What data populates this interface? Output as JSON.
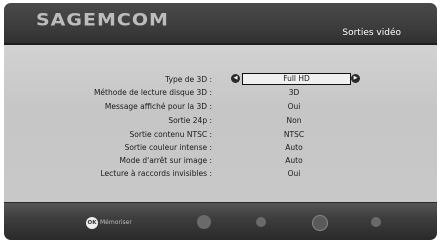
{
  "header": {
    "brand": "SAGEMCOM",
    "title": "Sorties vidéo"
  },
  "settings": [
    {
      "label": "Type de 3D :",
      "value": "Full HD"
    },
    {
      "label": "Méthode de lecture disque 3D :",
      "value": "3D"
    },
    {
      "label": "Message affiché pour la 3D :",
      "value": "Oui"
    },
    {
      "label": "Sortie  24p :",
      "value": "Non"
    },
    {
      "label": "Sortie contenu NTSC :",
      "value": "NTSC"
    },
    {
      "label": "Sortie couleur intense :",
      "value": "Auto"
    },
    {
      "label": "Mode d'arrêt sur image :",
      "value": "Auto"
    },
    {
      "label": "Lecture à raccords invisibles :",
      "value": "Oui"
    }
  ],
  "footer": {
    "ok_icon": "OK",
    "ok_label": "Mémoriser"
  },
  "icons": {
    "left": "left-arrow-icon",
    "right": "right-arrow-icon"
  },
  "colors": {
    "header_bg": "#3a3a3a",
    "content_bg": "#c8c8c8",
    "selector_bg": "#f0f0f0"
  }
}
